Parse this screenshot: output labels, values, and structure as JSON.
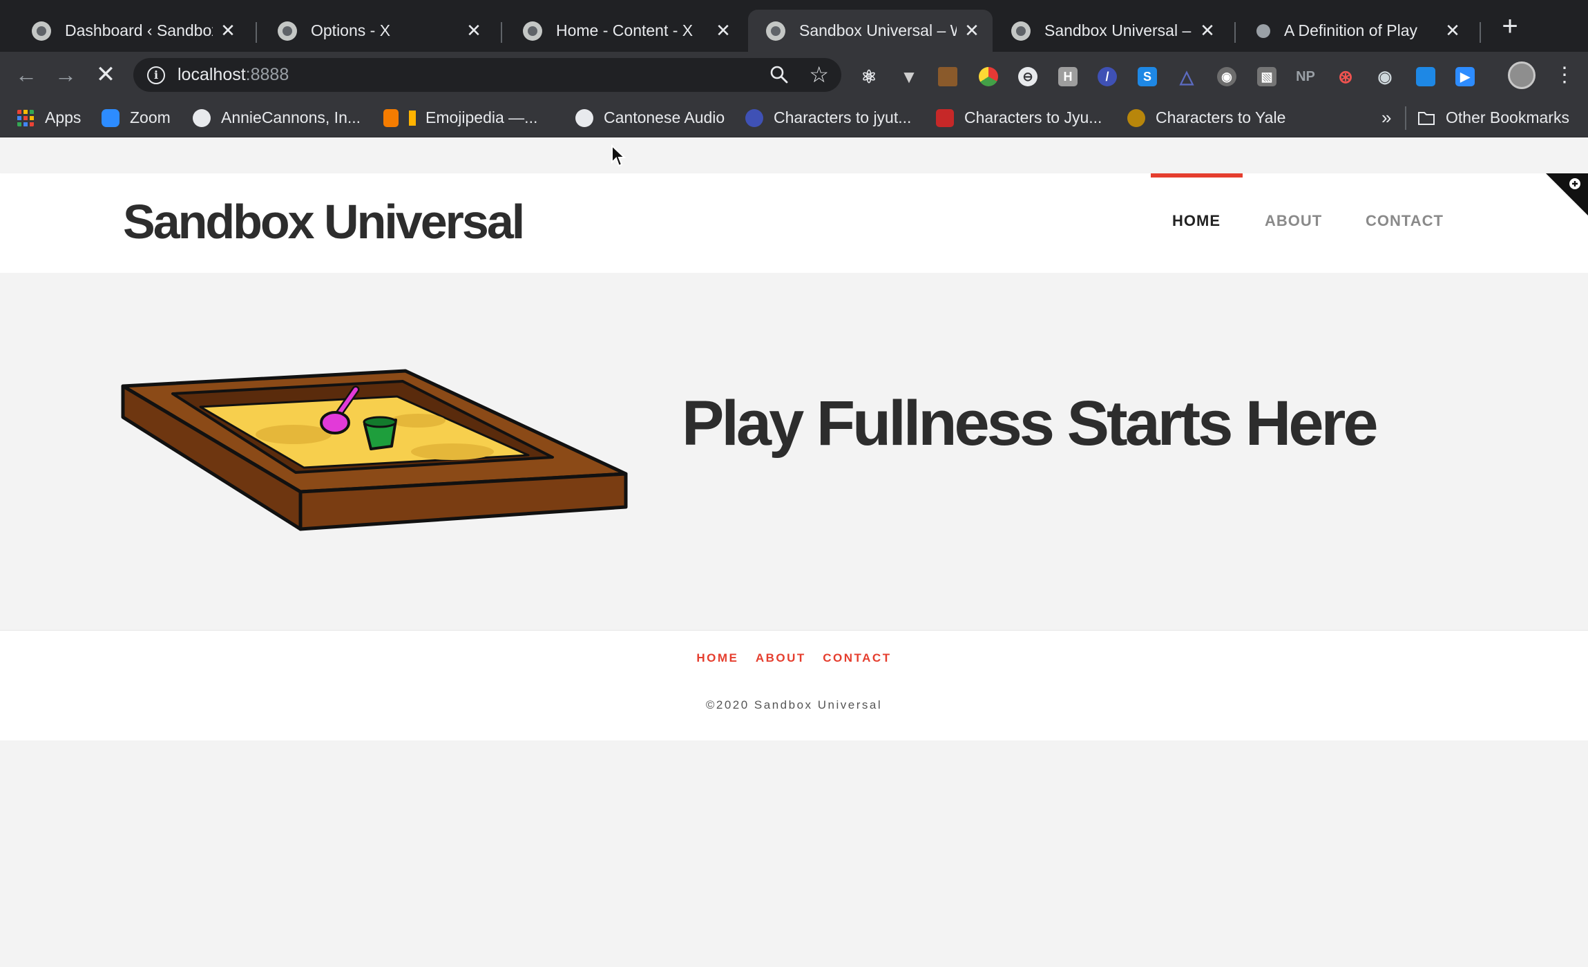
{
  "browser": {
    "tabs": [
      {
        "title": "Dashboard ‹ Sandbox U",
        "active": false
      },
      {
        "title": "Options - X",
        "active": false
      },
      {
        "title": "Home - Content - X",
        "active": false
      },
      {
        "title": "Sandbox Universal – W",
        "active": true
      },
      {
        "title": "Sandbox Universal – W",
        "active": false
      },
      {
        "title": "A Definition of Play",
        "active": false
      }
    ],
    "new_tab_label": "+",
    "close_glyph": "✕",
    "url_host": "localhost",
    "url_port": ":8888",
    "bookmarks": [
      {
        "label": "Apps",
        "icon": "apps-grid-icon"
      },
      {
        "label": "Zoom",
        "icon": "zoom-icon"
      },
      {
        "label": "AnnieCannons, In...",
        "icon": "github-icon"
      },
      {
        "label": "Emojipedia —...",
        "icon": "emojipedia-icon"
      },
      {
        "label": "Cantonese Audio",
        "icon": "globe-icon"
      },
      {
        "label": "Characters to jyut...",
        "icon": "bookmark-favicon-icon"
      },
      {
        "label": "Characters to Jyu...",
        "icon": "bookmark-favicon-icon"
      },
      {
        "label": "Characters to Yale",
        "icon": "bookmark-favicon-icon"
      }
    ],
    "bookmarks_overflow": "»",
    "other_bookmarks": "Other Bookmarks"
  },
  "site": {
    "brand": "Sandbox Universal",
    "nav": [
      "HOME",
      "ABOUT",
      "CONTACT"
    ],
    "active_nav": "HOME",
    "hero": {
      "title": "Play Fullness Starts Here",
      "text": ""
    },
    "footer_nav": [
      "HOME",
      "ABOUT",
      "CONTACT"
    ],
    "copyright": "©2020 Sandbox Universal",
    "accent_color": "#e53e2e"
  }
}
